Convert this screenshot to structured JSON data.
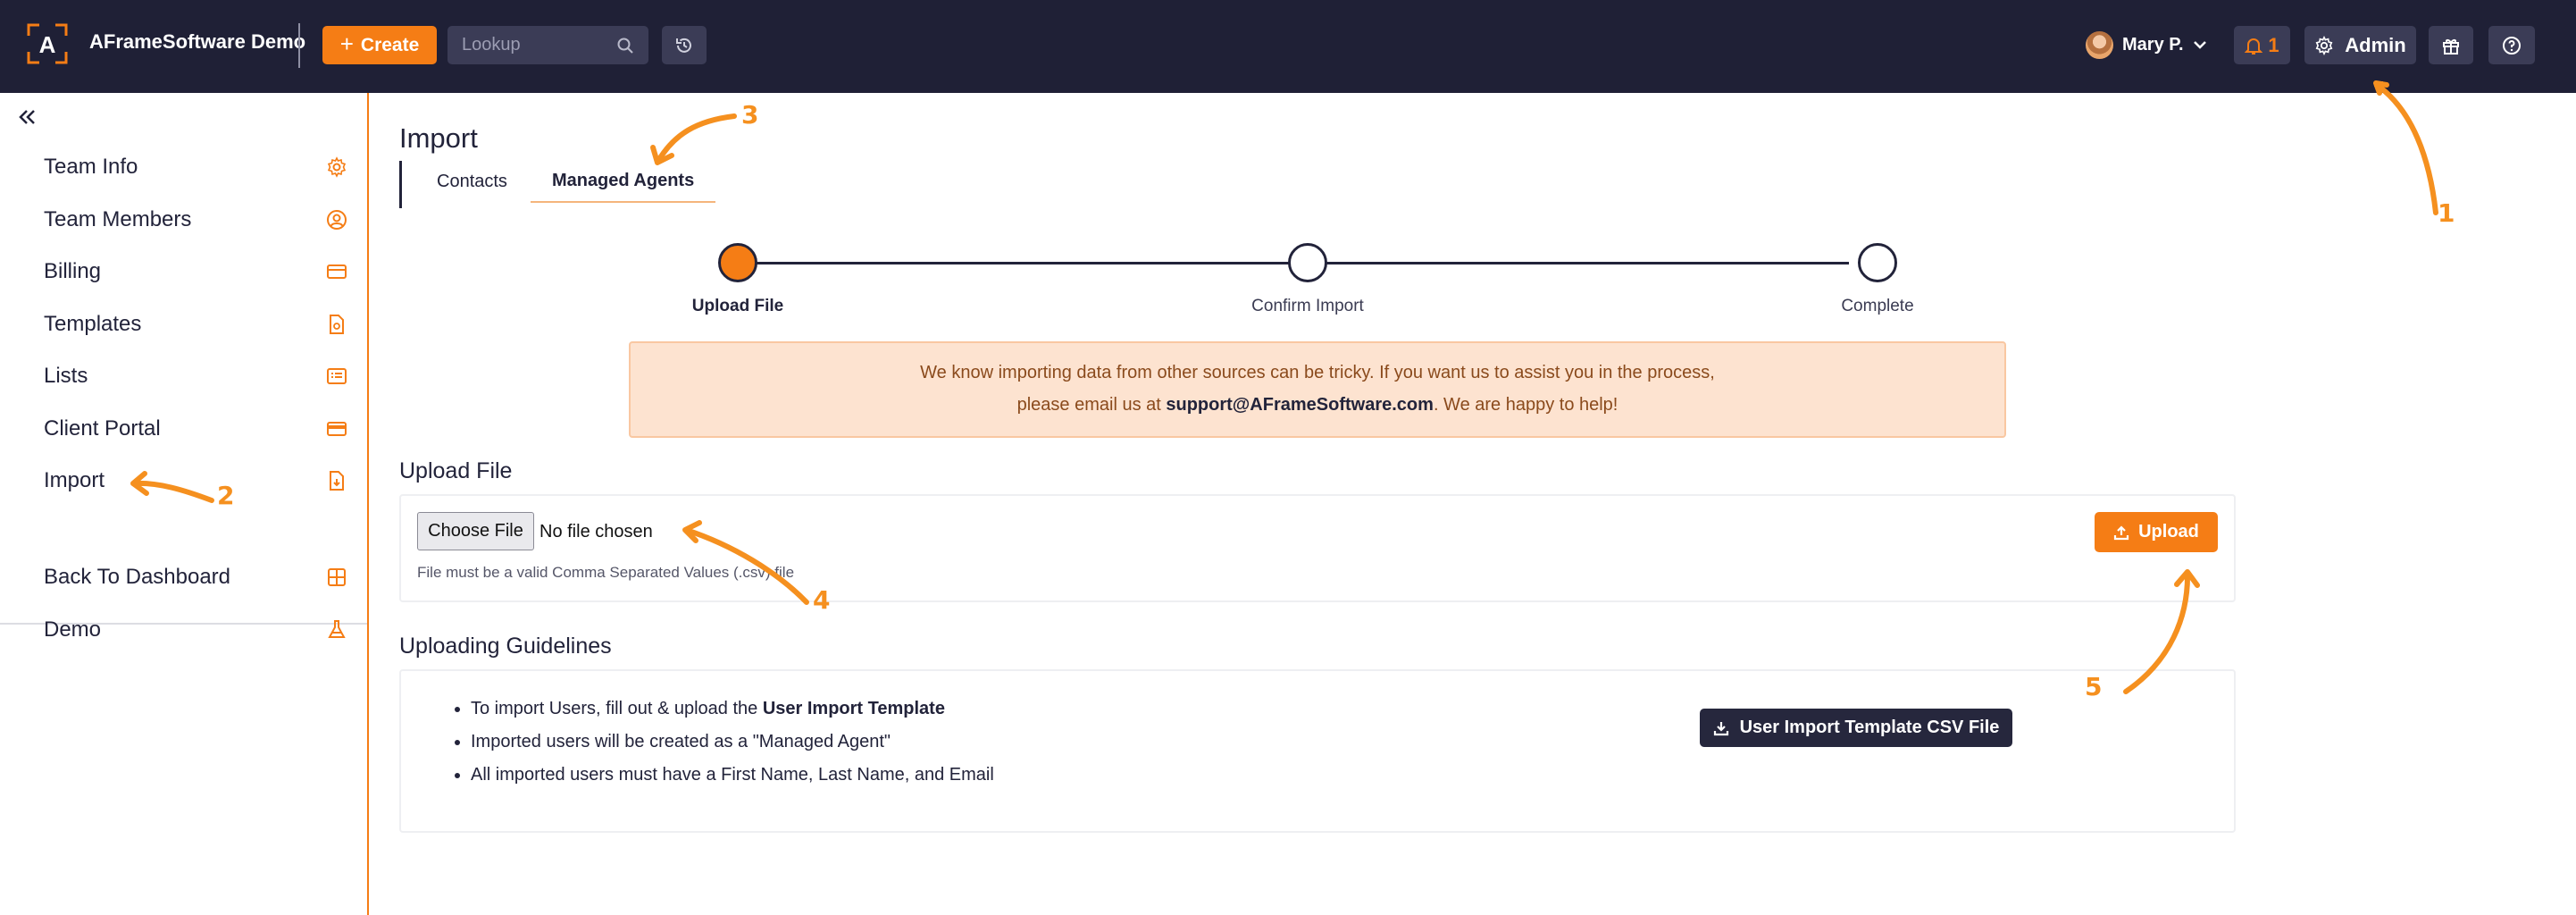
{
  "topbar": {
    "brand_letter": "A",
    "brand_name": "AFrameSoftware Demo",
    "create_label": "Create",
    "lookup_placeholder": "Lookup",
    "user_name": "Mary P.",
    "notification_count": "1",
    "admin_label": "Admin"
  },
  "sidebar": {
    "items": [
      {
        "label": "Team Info",
        "icon": "gear-icon"
      },
      {
        "label": "Team Members",
        "icon": "user-circle-icon"
      },
      {
        "label": "Billing",
        "icon": "credit-card-icon"
      },
      {
        "label": "Templates",
        "icon": "document-icon"
      },
      {
        "label": "Lists",
        "icon": "list-icon"
      },
      {
        "label": "Client Portal",
        "icon": "card-icon"
      },
      {
        "label": "Import",
        "icon": "file-import-icon"
      }
    ],
    "bottom_items": [
      {
        "label": "Back To Dashboard",
        "icon": "dashboard-grid-icon"
      },
      {
        "label": "Demo",
        "icon": "flask-icon"
      }
    ]
  },
  "main": {
    "title": "Import",
    "tabs": [
      {
        "label": "Contacts",
        "active": false
      },
      {
        "label": "Managed Agents",
        "active": true
      }
    ],
    "steps": [
      {
        "label": "Upload File",
        "current": true
      },
      {
        "label": "Confirm Import",
        "current": false
      },
      {
        "label": "Complete",
        "current": false
      }
    ],
    "notice": {
      "line1": "We know importing data from other sources can be tricky. If you want us to assist you in the process,",
      "line2_prefix": "please email us at ",
      "email": "support@AFrameSoftware.com",
      "line2_suffix": ". We are happy to help!"
    },
    "upload": {
      "section_title": "Upload File",
      "choose_label": "Choose File",
      "no_file_text": "No file chosen",
      "hint": "File must be a valid Comma Separated Values (.csv) file",
      "upload_label": "Upload"
    },
    "guidelines": {
      "section_title": "Uploading Guidelines",
      "item1_prefix": "To import Users, fill out & upload the ",
      "item1_bold": "User Import Template",
      "item2": "Imported users will be created as a \"Managed Agent\"",
      "item3": "All imported users must have a First Name, Last Name, and Email",
      "template_button": "User Import Template CSV File"
    }
  },
  "annotations": [
    "1",
    "2",
    "3",
    "4",
    "5"
  ],
  "colors": {
    "accent": "#f57d15",
    "nav_bg": "#1f2036",
    "annotation": "#f5901f"
  }
}
